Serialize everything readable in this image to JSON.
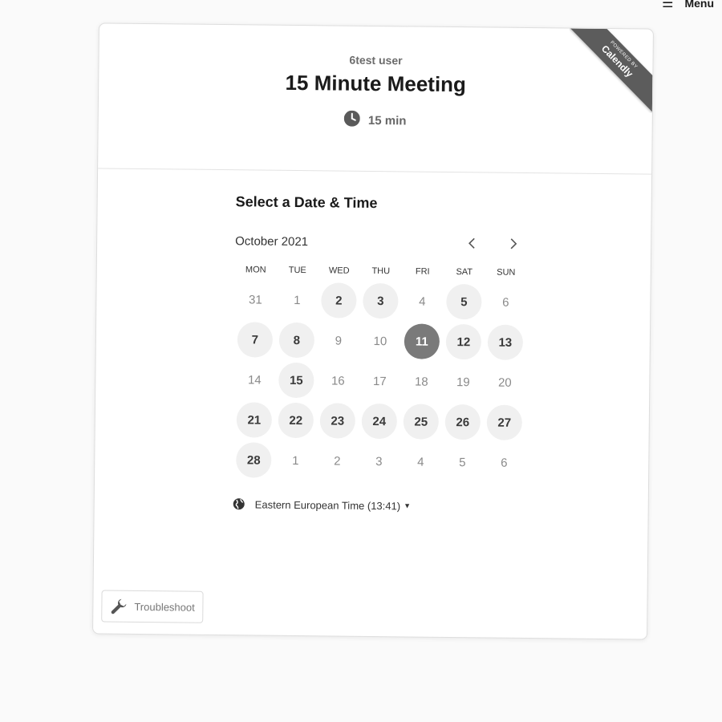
{
  "menu": {
    "icon": "hamburger-icon",
    "label": "Menu"
  },
  "ribbon": {
    "powered_by": "POWERED BY",
    "brand": "Calendly"
  },
  "event": {
    "owner": "6test user",
    "title": "15 Minute Meeting",
    "duration": "15 min",
    "duration_icon": "clock-icon"
  },
  "picker": {
    "heading": "Select a Date & Time",
    "month": "October 2021",
    "prev_icon": "chevron-left-icon",
    "next_icon": "chevron-right-icon",
    "weekdays": [
      "MON",
      "TUE",
      "WED",
      "THU",
      "FRI",
      "SAT",
      "SUN"
    ],
    "days": [
      {
        "label": "31",
        "state": "disabled"
      },
      {
        "label": "1",
        "state": "disabled"
      },
      {
        "label": "2",
        "state": "available"
      },
      {
        "label": "3",
        "state": "available"
      },
      {
        "label": "4",
        "state": "disabled"
      },
      {
        "label": "5",
        "state": "available"
      },
      {
        "label": "6",
        "state": "disabled"
      },
      {
        "label": "7",
        "state": "available"
      },
      {
        "label": "8",
        "state": "available"
      },
      {
        "label": "9",
        "state": "disabled"
      },
      {
        "label": "10",
        "state": "disabled"
      },
      {
        "label": "11",
        "state": "selected"
      },
      {
        "label": "12",
        "state": "available"
      },
      {
        "label": "13",
        "state": "available"
      },
      {
        "label": "14",
        "state": "disabled"
      },
      {
        "label": "15",
        "state": "available"
      },
      {
        "label": "16",
        "state": "disabled"
      },
      {
        "label": "17",
        "state": "disabled"
      },
      {
        "label": "18",
        "state": "disabled"
      },
      {
        "label": "19",
        "state": "disabled"
      },
      {
        "label": "20",
        "state": "disabled"
      },
      {
        "label": "21",
        "state": "available"
      },
      {
        "label": "22",
        "state": "available"
      },
      {
        "label": "23",
        "state": "available"
      },
      {
        "label": "24",
        "state": "available"
      },
      {
        "label": "25",
        "state": "available"
      },
      {
        "label": "26",
        "state": "available"
      },
      {
        "label": "27",
        "state": "available"
      },
      {
        "label": "28",
        "state": "available"
      },
      {
        "label": "1",
        "state": "disabled"
      },
      {
        "label": "2",
        "state": "disabled"
      },
      {
        "label": "3",
        "state": "disabled"
      },
      {
        "label": "4",
        "state": "disabled"
      },
      {
        "label": "5",
        "state": "disabled"
      },
      {
        "label": "6",
        "state": "disabled"
      }
    ],
    "timezone": "Eastern European Time (13:41)",
    "timezone_icon": "globe-icon"
  },
  "troubleshoot": {
    "label": "Troubleshoot",
    "icon": "wrench-icon"
  },
  "colors": {
    "selected": "#7a7a7a",
    "available_bg": "#f0f0f0",
    "ribbon": "#5c5c5c"
  }
}
